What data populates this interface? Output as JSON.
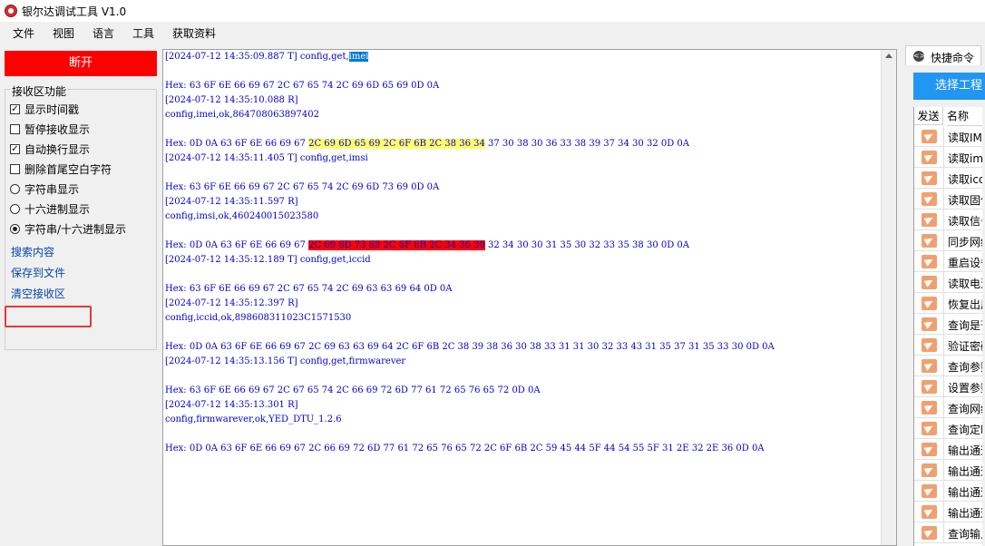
{
  "window": {
    "title": "银尔达调试工具 V1.0"
  },
  "menu": [
    "文件",
    "视图",
    "语言",
    "工具",
    "获取资料"
  ],
  "left": {
    "disconnect_label": "断开",
    "group_title": "接收区功能",
    "options": [
      {
        "label": "显示时间戳",
        "type": "checkbox",
        "checked": true
      },
      {
        "label": "暂停接收显示",
        "type": "checkbox",
        "checked": false
      },
      {
        "label": "自动换行显示",
        "type": "checkbox",
        "checked": true
      },
      {
        "label": "删除首尾空白字符",
        "type": "checkbox",
        "checked": false
      },
      {
        "label": "字符串显示",
        "type": "radio",
        "checked": false
      },
      {
        "label": "十六进制显示",
        "type": "radio",
        "checked": false
      },
      {
        "label": "字符串/十六进制显示",
        "type": "radio",
        "checked": true
      }
    ],
    "links": [
      "搜索内容",
      "保存到文件",
      "清空接收区"
    ]
  },
  "receive": {
    "lines": [
      {
        "segs": [
          {
            "t": "[2024-07-12 14:35:09.887 T] config,get,",
            "h": ""
          },
          {
            "t": "imei",
            "h": "sel"
          }
        ]
      },
      {
        "segs": [
          {
            "t": "",
            "h": ""
          }
        ]
      },
      {
        "segs": [
          {
            "t": "Hex: 63 6F 6E 66 69 67 2C 67 65 74 2C 69 6D 65 69 0D 0A",
            "h": ""
          }
        ]
      },
      {
        "segs": [
          {
            "t": "[2024-07-12 14:35:10.088 R]",
            "h": ""
          }
        ]
      },
      {
        "segs": [
          {
            "t": "config,imei,ok,864708063897402",
            "h": ""
          }
        ]
      },
      {
        "segs": [
          {
            "t": "",
            "h": ""
          }
        ]
      },
      {
        "segs": [
          {
            "t": "Hex: 0D 0A 63 6F 6E 66 69 67 ",
            "h": ""
          },
          {
            "t": "2C 69 6D 65 69 2C 6F 6B 2C 38 36 34",
            "h": "yel"
          },
          {
            "t": " 37 30 38 30 36 33 38 39 37 34 30 32 0D 0A",
            "h": ""
          }
        ]
      },
      {
        "segs": [
          {
            "t": "[2024-07-12 14:35:11.405 T] config,get,imsi",
            "h": ""
          }
        ]
      },
      {
        "segs": [
          {
            "t": "",
            "h": ""
          }
        ]
      },
      {
        "segs": [
          {
            "t": "Hex: 63 6F 6E 66 69 67 2C 67 65 74 2C 69 6D 73 69 0D 0A",
            "h": ""
          }
        ]
      },
      {
        "segs": [
          {
            "t": "[2024-07-12 14:35:11.597 R]",
            "h": ""
          }
        ]
      },
      {
        "segs": [
          {
            "t": "config,imsi,ok,460240015023580",
            "h": ""
          }
        ]
      },
      {
        "segs": [
          {
            "t": "",
            "h": ""
          }
        ]
      },
      {
        "segs": [
          {
            "t": "Hex: 0D 0A 63 6F 6E 66 69 67 ",
            "h": ""
          },
          {
            "t": "2C 69 6D 73 69 2C 6F 6B 2C 34 36 30",
            "h": "red"
          },
          {
            "t": " 32 34 30 30 31 35 30 32 33 35 38 30 0D 0A",
            "h": ""
          }
        ]
      },
      {
        "segs": [
          {
            "t": "[2024-07-12 14:35:12.189 T] config,get,iccid",
            "h": ""
          }
        ]
      },
      {
        "segs": [
          {
            "t": "",
            "h": ""
          }
        ]
      },
      {
        "segs": [
          {
            "t": "Hex: 63 6F 6E 66 69 67 2C 67 65 74 2C 69 63 63 69 64 0D 0A",
            "h": ""
          }
        ]
      },
      {
        "segs": [
          {
            "t": "[2024-07-12 14:35:12.397 R]",
            "h": ""
          }
        ]
      },
      {
        "segs": [
          {
            "t": "config,iccid,ok,898608311023C1571530",
            "h": ""
          }
        ]
      },
      {
        "segs": [
          {
            "t": "",
            "h": ""
          }
        ]
      },
      {
        "segs": [
          {
            "t": "Hex: 0D 0A 63 6F 6E 66 69 67 2C 69 63 63 69 64 2C 6F 6B 2C 38 39 38 36 30 38 33 31 31 30 32 33 43 31 35 37 31 35 33 30 0D 0A",
            "h": ""
          }
        ]
      },
      {
        "segs": [
          {
            "t": "[2024-07-12 14:35:13.156 T] config,get,firmwarever",
            "h": ""
          }
        ]
      },
      {
        "segs": [
          {
            "t": "",
            "h": ""
          }
        ]
      },
      {
        "segs": [
          {
            "t": "Hex: 63 6F 6E 66 69 67 2C 67 65 74 2C 66 69 72 6D 77 61 72 65 76 65 72 0D 0A",
            "h": ""
          }
        ]
      },
      {
        "segs": [
          {
            "t": "[2024-07-12 14:35:13.301 R]",
            "h": ""
          }
        ]
      },
      {
        "segs": [
          {
            "t": "config,firmwarever,ok,YED_DTU_1.2.6",
            "h": ""
          }
        ]
      },
      {
        "segs": [
          {
            "t": "",
            "h": ""
          }
        ]
      },
      {
        "segs": [
          {
            "t": "Hex: 0D 0A 63 6F 6E 66 69 67 2C 66 69 72 6D 77 61 72 65 76 65 72 2C 6F 6B 2C 59 45 44 5F 44 54 55 5F 31 2E 32 2E 36 0D 0A",
            "h": ""
          }
        ]
      }
    ]
  },
  "right": {
    "tab_label": "快捷命令",
    "select_btn": "选择工程",
    "col_send": "发送",
    "col_name": "名称",
    "commands": [
      "读取IMEI",
      "读取imsi",
      "读取iccid",
      "读取固件",
      "读取信号",
      "同步网络",
      "重启设备",
      "读取电池",
      "恢复出厂",
      "查询是否",
      "验证密码",
      "查询参数",
      "设置参数",
      "查询网络",
      "查询定时",
      "输出通道",
      "输出通道",
      "输出通道",
      "输出通道",
      "查询输入"
    ]
  }
}
